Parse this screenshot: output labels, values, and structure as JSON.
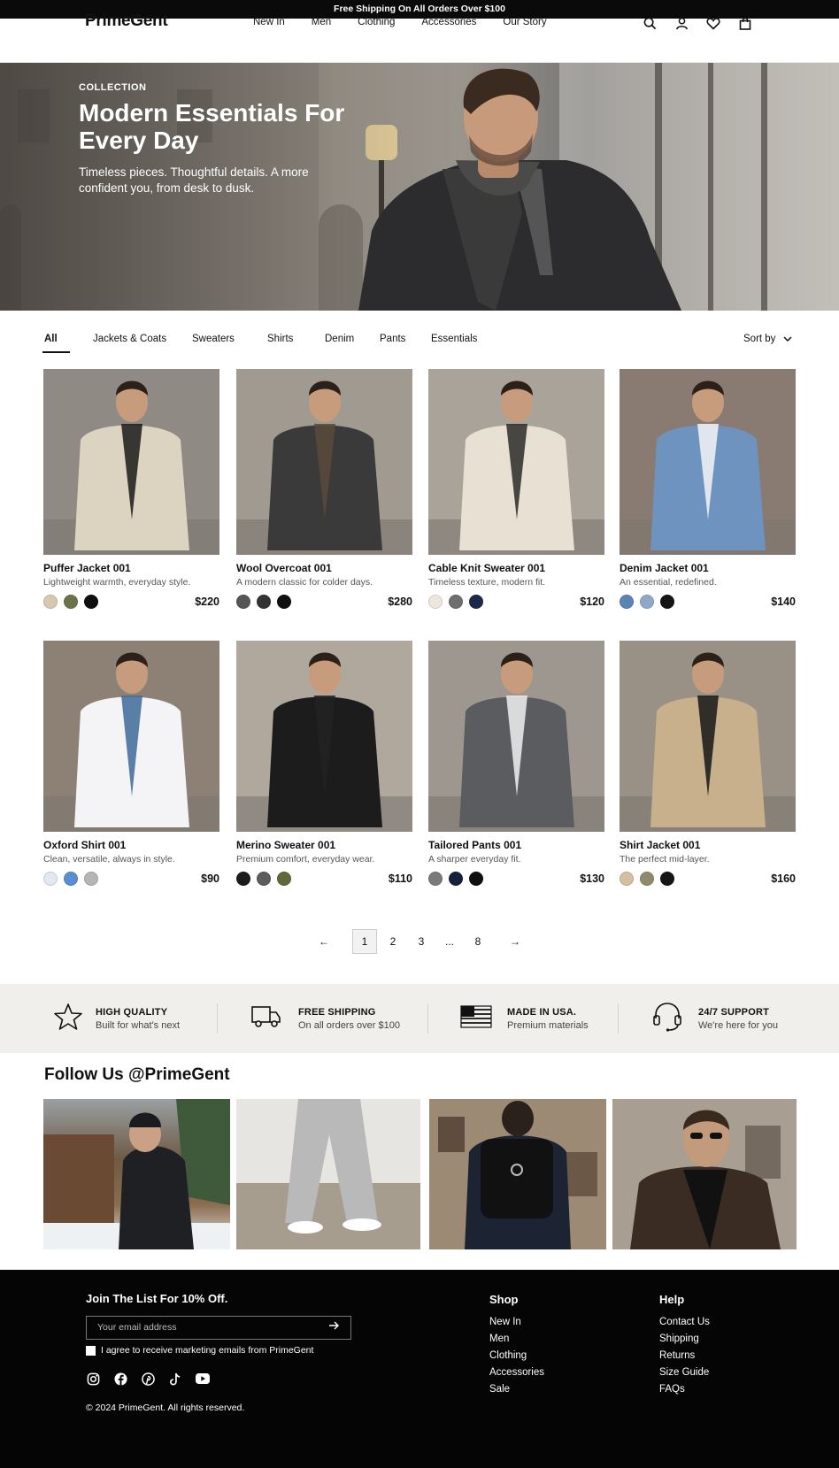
{
  "announcement": "Free Shipping On All Orders Over $100",
  "header": {
    "logo": "PrimeGent",
    "nav": [
      "New In",
      "Men",
      "Clothing",
      "Accessories",
      "Our Story"
    ],
    "icons": [
      "search-icon",
      "account-icon",
      "wishlist-icon",
      "bag-icon"
    ]
  },
  "hero": {
    "kicker": "COLLECTION",
    "title": "Modern Essentials For Every Day",
    "subtitle": "Timeless pieces. Thoughtful details. A more confident you, from desk to dusk."
  },
  "filters": {
    "tabs": [
      "All",
      "Jackets & Coats",
      "Sweaters",
      "Shirts",
      "Denim",
      "Pants",
      "Essentials"
    ],
    "active": "All",
    "sort_label": "Sort by"
  },
  "products": [
    {
      "name": "Puffer Jacket 001",
      "desc": "Lightweight warmth, everyday style.",
      "price": "$220",
      "swatches": [
        "#d8c8b0",
        "#6b7349",
        "#0f0f0f"
      ]
    },
    {
      "name": "Wool Overcoat 001",
      "desc": "A modern classic for colder days.",
      "price": "$280",
      "swatches": [
        "#555555",
        "#333333",
        "#0f0f0f"
      ]
    },
    {
      "name": "Cable Knit Sweater 001",
      "desc": "Timeless texture, modern fit.",
      "price": "$120",
      "swatches": [
        "#ece6de",
        "#6f6f6f",
        "#1b2a4a"
      ]
    },
    {
      "name": "Denim Jacket 001",
      "desc": "An essential, redefined.",
      "price": "$140",
      "swatches": [
        "#5b84b6",
        "#8ea9c8",
        "#151515"
      ]
    },
    {
      "name": "Oxford Shirt 001",
      "desc": "Clean, versatile, always in style.",
      "price": "$90",
      "swatches": [
        "#e2e8f2",
        "#5b8ed1",
        "#b5b5b5"
      ]
    },
    {
      "name": "Merino Sweater 001",
      "desc": "Premium comfort, everyday wear.",
      "price": "$110",
      "swatches": [
        "#1c1c1c",
        "#5c5c5c",
        "#5f6a3a"
      ]
    },
    {
      "name": "Tailored Pants 001",
      "desc": "A sharper everyday fit.",
      "price": "$130",
      "swatches": [
        "#7a7a7a",
        "#14213d",
        "#0f0f0f"
      ]
    },
    {
      "name": "Shirt Jacket 001",
      "desc": "The perfect mid-layer.",
      "price": "$160",
      "swatches": [
        "#d3c0a3",
        "#8f8b6a",
        "#151515"
      ]
    }
  ],
  "pagination": {
    "prev": "←",
    "pages": [
      "1",
      "2",
      "3",
      "...",
      "8"
    ],
    "current": "1",
    "next": "→"
  },
  "features": [
    {
      "icon": "star-icon",
      "title": "HIGH QUALITY",
      "text": "Built for what's next"
    },
    {
      "icon": "truck-icon",
      "title": "FREE SHIPPING",
      "text": "On all orders over $100"
    },
    {
      "icon": "usa-flag-icon",
      "title": "MADE IN USA.",
      "text": "Premium materials"
    },
    {
      "icon": "headset-icon",
      "title": "24/7 SUPPORT",
      "text": "We're here for you"
    }
  ],
  "follow": {
    "title": "Follow Us @PrimeGent"
  },
  "footer": {
    "join_title": "Join The List For 10% Off.",
    "email_placeholder": "Your email address",
    "consent": "I agree to receive marketing emails from PrimeGent",
    "social": [
      "instagram-icon",
      "facebook-icon",
      "pinterest-icon",
      "tiktok-icon",
      "youtube-icon"
    ],
    "copyright": "© 2024 PrimeGent. All rights reserved.",
    "shop": {
      "title": "Shop",
      "links": [
        "New In",
        "Men",
        "Clothing",
        "Accessories",
        "Sale"
      ]
    },
    "help": {
      "title": "Help",
      "links": [
        "Contact Us",
        "Shipping",
        "Returns",
        "Size Guide",
        "FAQs"
      ]
    }
  }
}
